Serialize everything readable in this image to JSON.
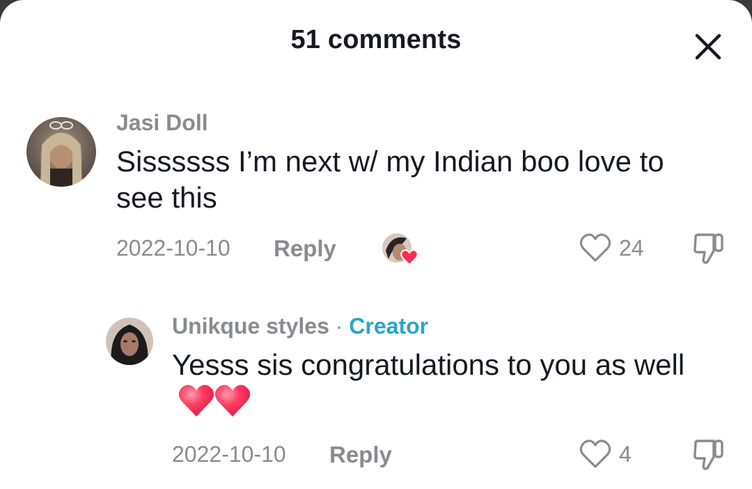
{
  "header": {
    "title": "51 comments"
  },
  "comments": [
    {
      "username": "Jasi Doll",
      "text": "Sissssss I’m next w/ my Indian boo love to see this",
      "date": "2022-10-10",
      "reply_label": "Reply",
      "like_count": "24",
      "creator_liked": true
    },
    {
      "username": "Unikque styles",
      "separator": "·",
      "creator_label": "Creator",
      "text": "Yesss sis congratulations to you as well",
      "emoji": "two-hearts",
      "date": "2022-10-10",
      "reply_label": "Reply",
      "like_count": "4"
    }
  ],
  "icons": {
    "close": "close-icon",
    "like": "heart-outline-icon",
    "dislike": "thumbs-down-icon"
  },
  "colors": {
    "creator": "#2aa4c9",
    "heart": "#fe2c55",
    "muted": "#8a8b91",
    "text": "#161823"
  }
}
